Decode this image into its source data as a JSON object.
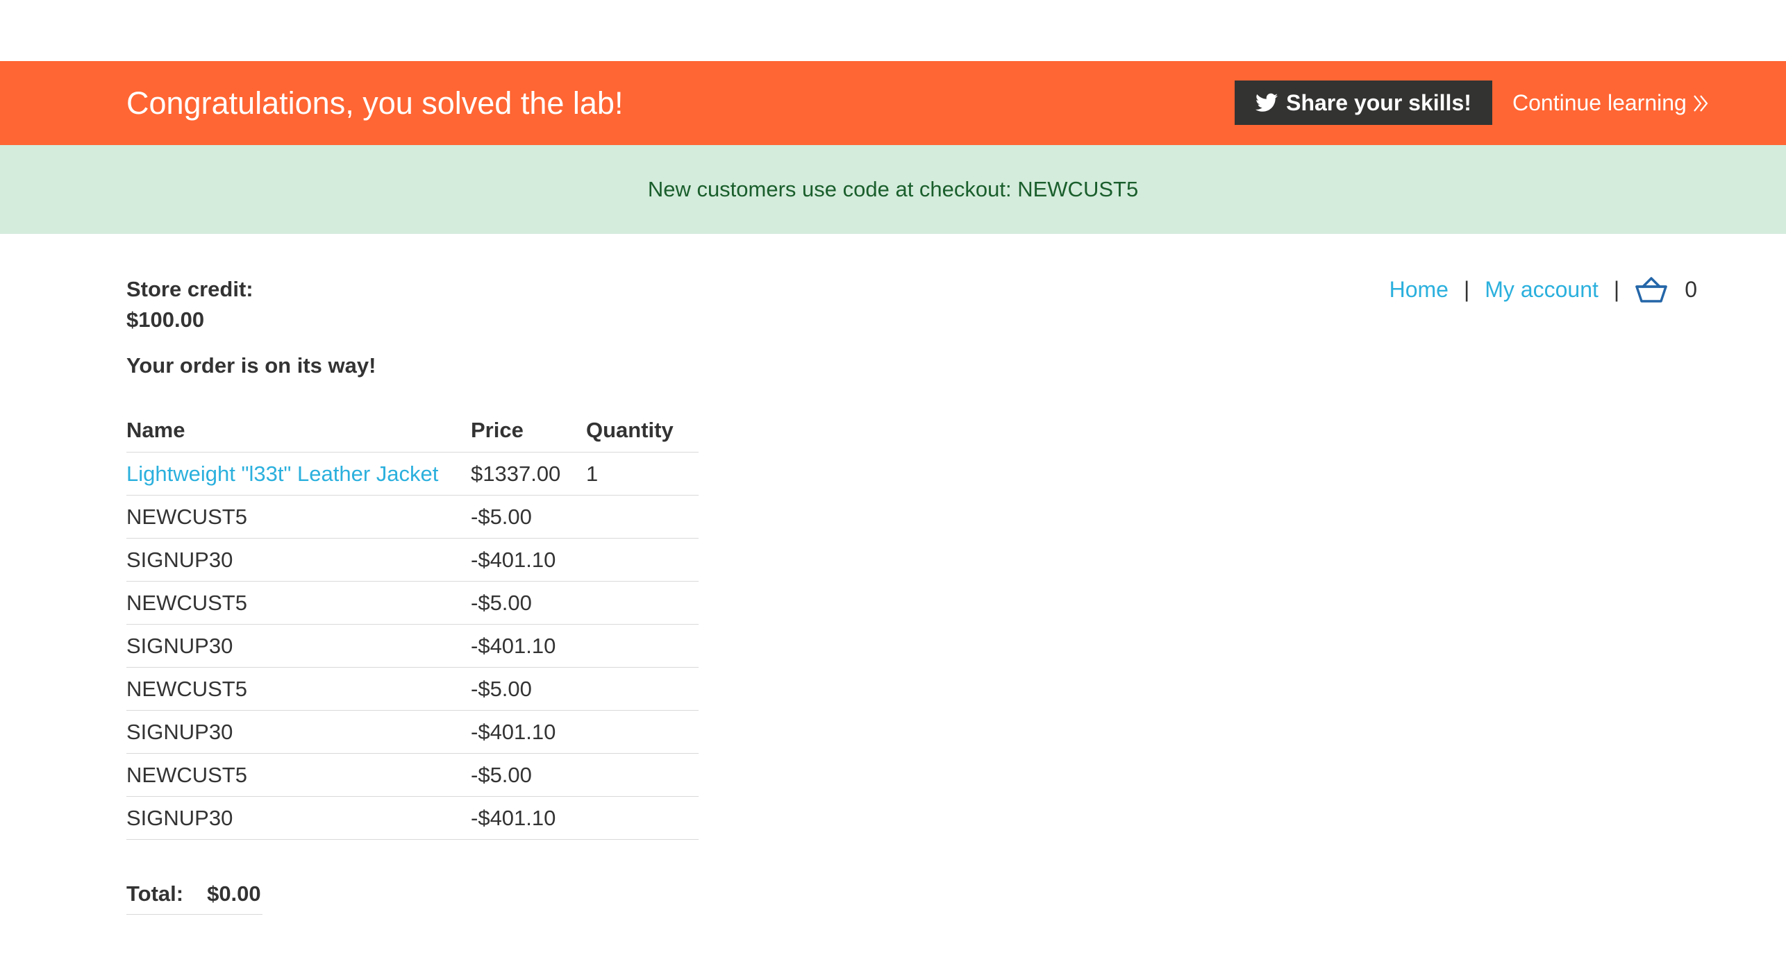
{
  "banner": {
    "title": "Congratulations, you solved the lab!",
    "share_label": "Share your skills!",
    "continue_label": "Continue learning",
    "background_color": "#ff6633"
  },
  "notice": {
    "text": "New customers use code at checkout: NEWCUST5"
  },
  "account": {
    "store_credit_label": "Store credit:",
    "store_credit_value": "$100.00"
  },
  "nav": {
    "home": "Home",
    "my_account": "My account",
    "separator": "|",
    "cart_icon": "basket-icon",
    "cart_count": "0"
  },
  "order": {
    "message": "Your order is on its way!",
    "headers": [
      "Name",
      "Price",
      "Quantity"
    ],
    "rows": [
      {
        "name": "Lightweight \"l33t\" Leather Jacket",
        "price": "$1337.00",
        "quantity": "1",
        "is_link": true
      },
      {
        "name": "NEWCUST5",
        "price": "-$5.00",
        "quantity": ""
      },
      {
        "name": "SIGNUP30",
        "price": "-$401.10",
        "quantity": ""
      },
      {
        "name": "NEWCUST5",
        "price": "-$5.00",
        "quantity": ""
      },
      {
        "name": "SIGNUP30",
        "price": "-$401.10",
        "quantity": ""
      },
      {
        "name": "NEWCUST5",
        "price": "-$5.00",
        "quantity": ""
      },
      {
        "name": "SIGNUP30",
        "price": "-$401.10",
        "quantity": ""
      },
      {
        "name": "NEWCUST5",
        "price": "-$5.00",
        "quantity": ""
      },
      {
        "name": "SIGNUP30",
        "price": "-$401.10",
        "quantity": ""
      }
    ],
    "total_label": "Total:",
    "total_value": "$0.00"
  },
  "colors": {
    "link": "#2bb0dd",
    "notice_bg": "#d4ecdc",
    "notice_text": "#1a5e2c",
    "share_button_bg": "#333332"
  }
}
